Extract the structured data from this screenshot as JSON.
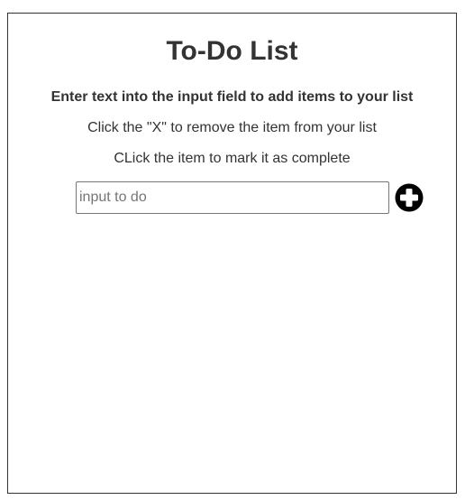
{
  "header": {
    "title": "To-Do List"
  },
  "instructions": {
    "line1": "Enter text into the input field to add items to your list",
    "line2": "Click the \"X\" to remove the item from your list",
    "line3": "CLick the item to mark it as complete"
  },
  "input": {
    "placeholder": "input to do",
    "value": ""
  },
  "add_button": {
    "icon": "plus-circle-icon",
    "color": "#000000"
  },
  "todo_items": []
}
